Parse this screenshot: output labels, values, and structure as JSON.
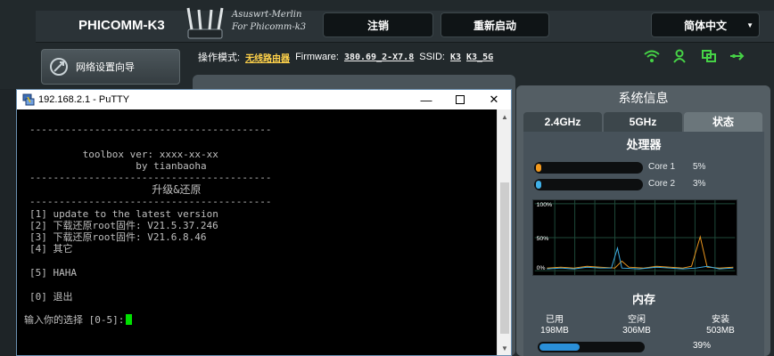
{
  "router": {
    "brand": "PHICOMM-K3",
    "logo_line1": "Asuswrt-Merlin",
    "logo_line2": "For Phicomm-k3",
    "logout_label": "注销",
    "reboot_label": "重新启动",
    "language": "简体中文",
    "menu_item": "网络设置向导",
    "status": {
      "mode_label": "操作模式:",
      "mode_value": "无线路由器",
      "firmware_label": "Firmware:",
      "firmware_value": "380.69_2-X7.8",
      "ssid_label": "SSID:",
      "ssid1": "K3",
      "ssid2": "K3_5G"
    },
    "colors": {
      "accent_green": "#46d246",
      "yellow": "#ffd24a"
    }
  },
  "system_panel": {
    "title": "系统信息",
    "tabs": [
      "2.4GHz",
      "5GHz",
      "状态"
    ],
    "active_tab": 2,
    "cpu": {
      "title": "处理器",
      "cores": [
        {
          "label": "Core 1",
          "pct_text": "5%",
          "value": 5,
          "color": "#f39a1e"
        },
        {
          "label": "Core 2",
          "pct_text": "3%",
          "value": 3,
          "color": "#3fb0e8"
        }
      ],
      "chart_ticks": [
        "100%",
        "50%",
        "0%"
      ]
    },
    "memory": {
      "title": "内存",
      "used_label": "已用",
      "used_value": "198MB",
      "free_label": "空闲",
      "free_value": "306MB",
      "total_label": "安装",
      "total_value": "503MB",
      "pct_text": "39%",
      "value": 39
    }
  },
  "putty": {
    "title": "192.168.2.1 - PuTTY",
    "lines": [
      "-----------------------------------------",
      "",
      "         toolbox ver: xxxx-xx-xx",
      "                  by tianbaoha",
      "-----------------------------------------",
      "                   升级&还原",
      "-----------------------------------------",
      "[1] update to the latest version",
      "[2] 下载还原root固件: V21.5.37.246",
      "[3] 下载还原root固件: V21.6.8.46",
      "[4] 其它",
      "",
      "[5] HAHA",
      "",
      "[0] 退出",
      "",
      "输入你的选择 [0-5]:"
    ]
  }
}
